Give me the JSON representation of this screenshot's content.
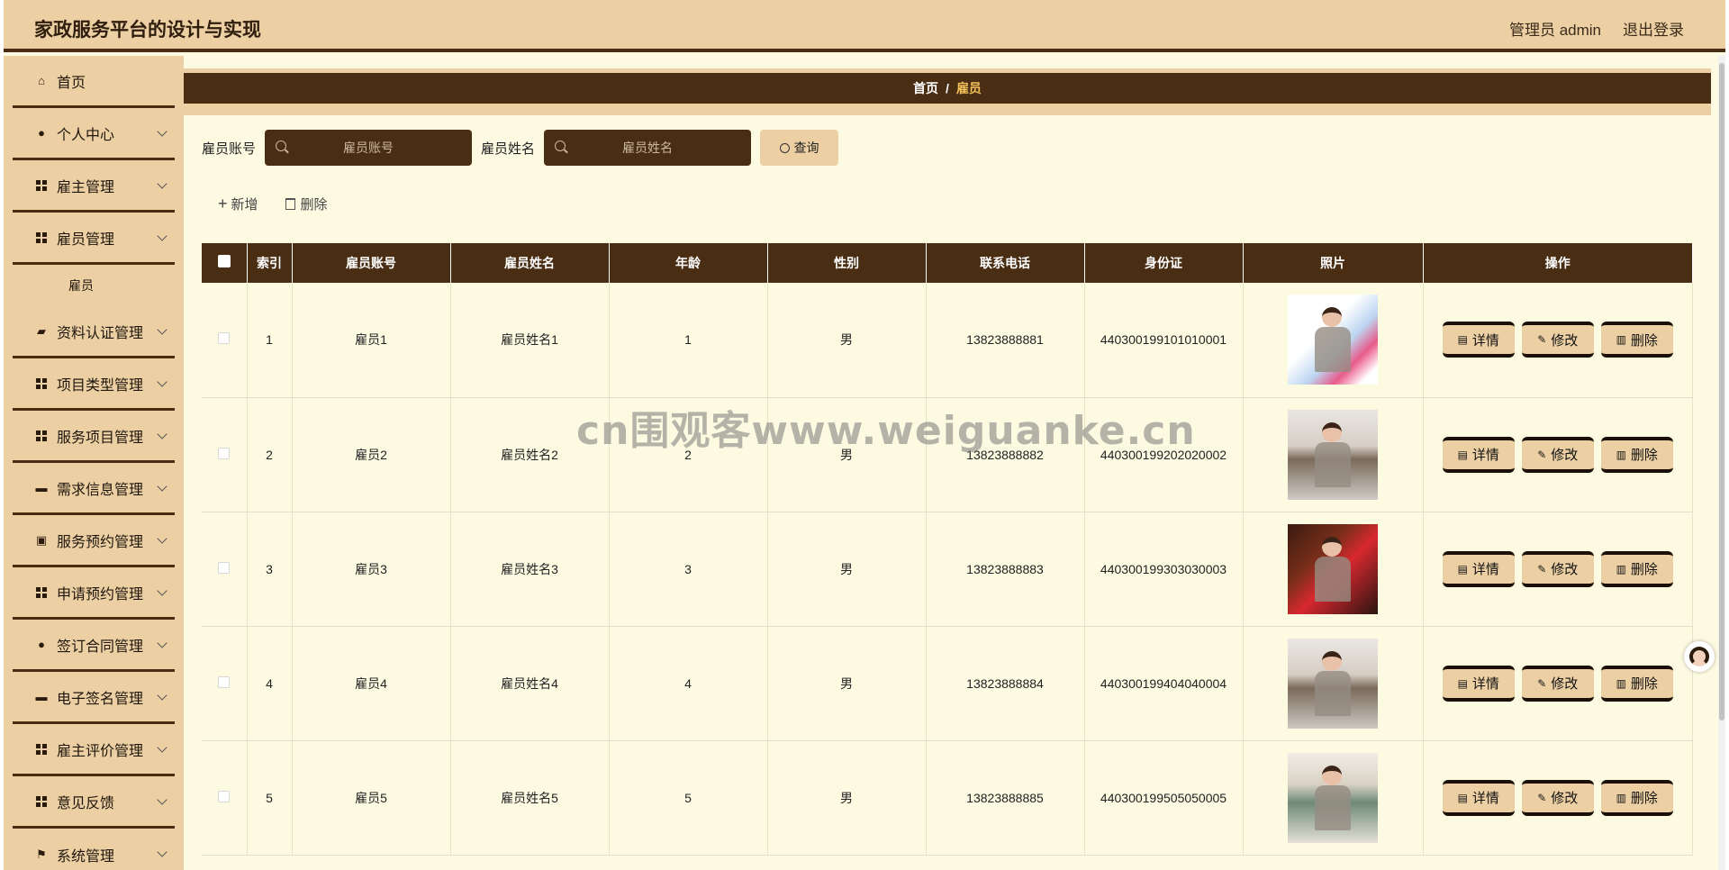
{
  "header": {
    "title": "家政服务平台的设计与实现",
    "user_label": "管理员 admin",
    "logout_label": "退出登录"
  },
  "sidebar": {
    "items": [
      {
        "label": "首页",
        "icon": "home-icon",
        "has_children": false
      },
      {
        "label": "个人中心",
        "icon": "user-icon",
        "has_children": true
      },
      {
        "label": "雇主管理",
        "icon": "grid-icon",
        "has_children": true
      },
      {
        "label": "雇员管理",
        "icon": "grid-icon",
        "has_children": true,
        "expanded": true,
        "children": [
          "雇员"
        ]
      },
      {
        "label": "资料认证管理",
        "icon": "briefcase-icon",
        "has_children": true
      },
      {
        "label": "项目类型管理",
        "icon": "grid-icon",
        "has_children": true
      },
      {
        "label": "服务项目管理",
        "icon": "grid-icon",
        "has_children": true
      },
      {
        "label": "需求信息管理",
        "icon": "monitor-icon",
        "has_children": true
      },
      {
        "label": "服务预约管理",
        "icon": "clipboard-icon",
        "has_children": true
      },
      {
        "label": "申请预约管理",
        "icon": "grid-icon",
        "has_children": true
      },
      {
        "label": "签订合同管理",
        "icon": "user-icon",
        "has_children": true
      },
      {
        "label": "电子签名管理",
        "icon": "chat-icon",
        "has_children": true
      },
      {
        "label": "雇主评价管理",
        "icon": "grid-icon",
        "has_children": true
      },
      {
        "label": "意见反馈",
        "icon": "grid-icon",
        "has_children": true
      },
      {
        "label": "系统管理",
        "icon": "flag-icon",
        "has_children": true
      }
    ]
  },
  "breadcrumb": {
    "home": "首页",
    "separator": "/",
    "current": "雇员"
  },
  "search": {
    "account_label": "雇员账号",
    "account_placeholder": "雇员账号",
    "name_label": "雇员姓名",
    "name_placeholder": "雇员姓名",
    "query_label": "查询"
  },
  "actions": {
    "add_label": "新增",
    "delete_label": "删除"
  },
  "table": {
    "columns": [
      "索引",
      "雇员账号",
      "雇员姓名",
      "年龄",
      "性别",
      "联系电话",
      "身份证",
      "照片",
      "操作"
    ],
    "rows": [
      {
        "index": "1",
        "account": "雇员1",
        "name": "雇员姓名1",
        "age": "1",
        "gender": "男",
        "phone": "13823888881",
        "id_card": "440300199101010001"
      },
      {
        "index": "2",
        "account": "雇员2",
        "name": "雇员姓名2",
        "age": "2",
        "gender": "男",
        "phone": "13823888882",
        "id_card": "440300199202020002"
      },
      {
        "index": "3",
        "account": "雇员3",
        "name": "雇员姓名3",
        "age": "3",
        "gender": "男",
        "phone": "13823888883",
        "id_card": "440300199303030003"
      },
      {
        "index": "4",
        "account": "雇员4",
        "name": "雇员姓名4",
        "age": "4",
        "gender": "男",
        "phone": "13823888884",
        "id_card": "440300199404040004"
      },
      {
        "index": "5",
        "account": "雇员5",
        "name": "雇员姓名5",
        "age": "5",
        "gender": "男",
        "phone": "13823888885",
        "id_card": "440300199505050005"
      }
    ],
    "row_actions": {
      "detail": "详情",
      "edit": "修改",
      "delete": "删除"
    }
  },
  "watermark": "cn围观客www.weiguanke.cn",
  "colors": {
    "header_bg": "#ecd0a4",
    "dark_brown": "#4a2e14",
    "content_bg": "#fdfae2",
    "breadcrumb_current": "#f5c15a"
  }
}
